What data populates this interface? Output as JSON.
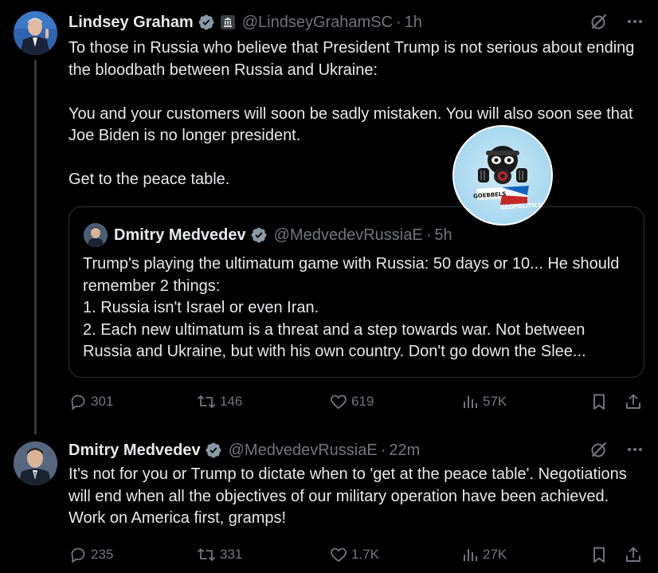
{
  "tweet1": {
    "author_name": "Lindsey Graham",
    "handle": "@LindseyGrahamSC",
    "separator": "·",
    "time": "1h",
    "text": "To those in Russia who believe that President Trump is not serious about ending the bloodbath between Russia and Ukraine:\n\nYou and your customers will soon be sadly mistaken. You will also soon see that Joe Biden is no longer president.\n\nGet to the peace table.",
    "quote": {
      "author_name": "Dmitry Medvedev",
      "handle": "@MedvedevRussiaE",
      "separator": "·",
      "time": "5h",
      "text": "Trump's playing the ultimatum game with Russia: 50 days or 10... He should remember 2 things:\n1. Russia isn't Israel or even Iran.\n2. Each new ultimatum is a threat and a step towards war. Not between Russia and Ukraine, but with his own country. Don't go down the Slee..."
    },
    "actions": {
      "replies": "301",
      "reposts": "146",
      "likes": "619",
      "views": "57K"
    }
  },
  "tweet2": {
    "author_name": "Dmitry Medvedev",
    "handle": "@MedvedevRussiaE",
    "separator": "·",
    "time": "22m",
    "text": "It's not for you or Trump to dictate when to 'get at the peace table'. Negotiations will end when all the objectives of our military operation have been achieved. Work on America first, gramps!",
    "actions": {
      "replies": "235",
      "reposts": "331",
      "likes": "1.7K",
      "views": "27K"
    }
  },
  "watermark": {
    "line1": "GOEBBELS",
    "line2": "GEOPOLITICS"
  },
  "icons": {
    "verified": "verified-badge-icon",
    "government": "government-badge-icon",
    "grok": "grok-icon",
    "more": "more-icon",
    "reply": "reply-icon",
    "repost": "repost-icon",
    "like": "like-icon",
    "views": "views-icon",
    "bookmark": "bookmark-icon",
    "share": "share-icon"
  },
  "colors": {
    "background": "#000000",
    "text": "#e7e9ea",
    "muted": "#71767b",
    "verified": "#1d9bf0",
    "border": "#2f3336"
  }
}
